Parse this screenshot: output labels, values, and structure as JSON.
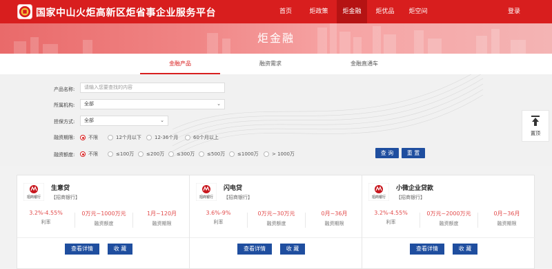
{
  "header": {
    "site_title": "国家中山火炬高新区炬省事企业服务平台",
    "nav": [
      {
        "label": "首页",
        "active": false
      },
      {
        "label": "炬政策",
        "active": false
      },
      {
        "label": "炬金融",
        "active": true
      },
      {
        "label": "炬优品",
        "active": false
      },
      {
        "label": "炬空间",
        "active": false
      }
    ],
    "login_label": "登录"
  },
  "banner": {
    "title": "炬金融"
  },
  "tabs": [
    {
      "label": "金融产品",
      "active": true
    },
    {
      "label": "融资需求",
      "active": false
    },
    {
      "label": "金融直通车",
      "active": false
    }
  ],
  "filter": {
    "product_name": {
      "label": "产品名称:",
      "placeholder": "请输入您要查找的内容",
      "value": ""
    },
    "institution": {
      "label": "所属机构:",
      "value": "全部"
    },
    "guarantee": {
      "label": "担保方式:",
      "value": "全部"
    },
    "term": {
      "label": "融资期限:",
      "options": [
        "不限",
        "12个月以下",
        "12-36个月",
        "60个月以上"
      ],
      "selected": 0
    },
    "amount": {
      "label": "融资额度:",
      "options": [
        "不限",
        "≤100万",
        "≤200万",
        "≤300万",
        "≤500万",
        "≤1000万",
        "> 1000万"
      ],
      "selected": 0
    },
    "search_label": "查 询",
    "reset_label": "重 置"
  },
  "side": {
    "back_to_top_label": "置顶"
  },
  "cards": [
    {
      "name": "生意贷",
      "bank": "【招商银行】",
      "logo_text": "招商银行",
      "stats": [
        {
          "value": "3.2%-4.55%",
          "label": "利率"
        },
        {
          "value": "0万元~1000万元",
          "label": "融资额度"
        },
        {
          "value": "1月~120月",
          "label": "融资期限"
        }
      ],
      "detail_label": "查看详情",
      "fav_label": "收 藏"
    },
    {
      "name": "闪电贷",
      "bank": "【招商银行】",
      "logo_text": "招商银行",
      "stats": [
        {
          "value": "3.6%-9%",
          "label": "利率"
        },
        {
          "value": "0万元~30万元",
          "label": "融资额度"
        },
        {
          "value": "0月~36月",
          "label": "融资期限"
        }
      ],
      "detail_label": "查看详情",
      "fav_label": "收 藏"
    },
    {
      "name": "小微企业贷款",
      "bank": "【招商银行】",
      "logo_text": "招商银行",
      "stats": [
        {
          "value": "3.2%-4.55%",
          "label": "利率"
        },
        {
          "value": "0万元~2000万元",
          "label": "融资额度"
        },
        {
          "value": "0月~36月",
          "label": "融资期限"
        }
      ],
      "detail_label": "查看详情",
      "fav_label": "收 藏"
    }
  ],
  "colors": {
    "brand_red": "#d81e1e",
    "button_blue": "#1f4e9f",
    "stat_red": "#e24b4b"
  }
}
